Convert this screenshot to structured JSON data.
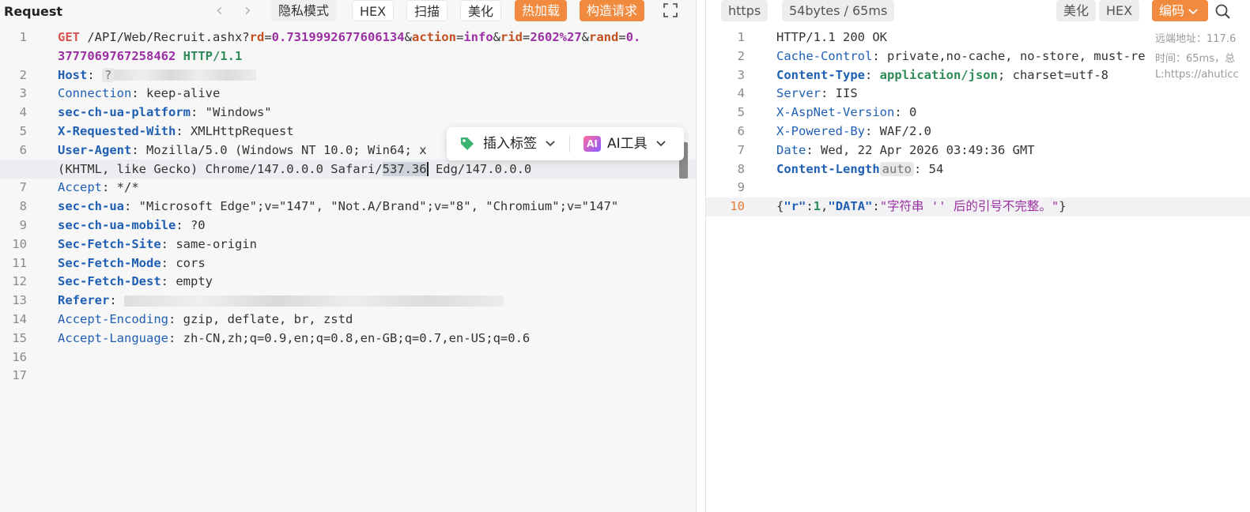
{
  "request": {
    "title": "Request",
    "nav_back": "‹",
    "nav_forward": "›",
    "buttons": {
      "private_mode": "隐私模式",
      "hex": "HEX",
      "scan": "扫描",
      "beautify": "美化",
      "hot_reload": "热加载",
      "construct": "构造请求"
    },
    "lines": [
      {
        "n": "1",
        "parts": [
          [
            "method",
            "GET"
          ],
          [
            "plain",
            " /API/Web/Recruit.ashx?"
          ],
          [
            "pname",
            "rd"
          ],
          [
            "plain",
            "="
          ],
          [
            "pval",
            "0.7319992677606134"
          ],
          [
            "plain",
            "&"
          ],
          [
            "pname",
            "action"
          ],
          [
            "plain",
            "="
          ],
          [
            "pval",
            "info"
          ],
          [
            "plain",
            "&"
          ],
          [
            "pname",
            "rid"
          ],
          [
            "plain",
            "="
          ],
          [
            "pval",
            "2602%27"
          ],
          [
            "plain",
            "&"
          ],
          [
            "pname",
            "rand"
          ],
          [
            "plain",
            "="
          ],
          [
            "pval",
            "0."
          ]
        ]
      },
      {
        "n": "",
        "parts": [
          [
            "pval",
            "3777069767258462"
          ],
          [
            "plain",
            " "
          ],
          [
            "proto",
            "HTTP/1.1"
          ]
        ]
      },
      {
        "n": "2",
        "parts": [
          [
            "keyb",
            "Host"
          ],
          [
            "plain",
            ": "
          ],
          [
            "chip",
            "?"
          ],
          [
            "blur",
            "180"
          ]
        ]
      },
      {
        "n": "3",
        "parts": [
          [
            "key",
            "Connection"
          ],
          [
            "plain",
            ": keep-alive"
          ]
        ]
      },
      {
        "n": "4",
        "parts": [
          [
            "keyb",
            "sec-ch-ua-platform"
          ],
          [
            "plain",
            ": \"Windows\""
          ]
        ]
      },
      {
        "n": "5",
        "parts": [
          [
            "keyb",
            "X-Requested-With"
          ],
          [
            "plain",
            ": XMLHttpRequest"
          ]
        ]
      },
      {
        "n": "6",
        "parts": [
          [
            "keyb",
            "User-Agent"
          ],
          [
            "plain",
            ": Mozilla/5.0 (Windows NT 10.0; Win64; x"
          ]
        ]
      },
      {
        "n": "",
        "parts": [
          [
            "plain",
            "(KHTML, like Gecko) Chrome/147.0.0.0 Safari/"
          ],
          [
            "sel",
            "537.36"
          ],
          [
            "cursor",
            ""
          ],
          [
            "plain",
            " Edg/147.0.0.0"
          ]
        ]
      },
      {
        "n": "7",
        "parts": [
          [
            "key",
            "Accept"
          ],
          [
            "plain",
            ": */*"
          ]
        ]
      },
      {
        "n": "8",
        "parts": [
          [
            "keyb",
            "sec-ch-ua"
          ],
          [
            "plain",
            ": \"Microsoft Edge\";v=\"147\", \"Not.A/Brand\";v=\"8\", \"Chromium\";v=\"147\""
          ]
        ]
      },
      {
        "n": "9",
        "parts": [
          [
            "keyb",
            "sec-ch-ua-mobile"
          ],
          [
            "plain",
            ": ?0"
          ]
        ]
      },
      {
        "n": "10",
        "parts": [
          [
            "keyb",
            "Sec-Fetch-Site"
          ],
          [
            "plain",
            ": same-origin"
          ]
        ]
      },
      {
        "n": "11",
        "parts": [
          [
            "keyb",
            "Sec-Fetch-Mode"
          ],
          [
            "plain",
            ": cors"
          ]
        ]
      },
      {
        "n": "12",
        "parts": [
          [
            "keyb",
            "Sec-Fetch-Dest"
          ],
          [
            "plain",
            ": empty"
          ]
        ]
      },
      {
        "n": "13",
        "parts": [
          [
            "keyb",
            "Referer"
          ],
          [
            "plain",
            ": "
          ],
          [
            "blur",
            "480"
          ]
        ]
      },
      {
        "n": "14",
        "parts": [
          [
            "key",
            "Accept-Encoding"
          ],
          [
            "plain",
            ": gzip, deflate, br, zstd"
          ]
        ]
      },
      {
        "n": "15",
        "parts": [
          [
            "key",
            "Accept-Language"
          ],
          [
            "plain",
            ": zh-CN,zh;q=0.9,en;q=0.8,en-GB;q=0.7,en-US;q=0.6"
          ]
        ]
      },
      {
        "n": "16",
        "parts": []
      },
      {
        "n": "17",
        "parts": []
      }
    ]
  },
  "popup": {
    "insert_tag": "插入标签",
    "ai_badge": "AI",
    "ai_tools": "AI工具"
  },
  "response": {
    "protocol_badge": "https",
    "size_time_badge": "54bytes / 65ms",
    "buttons": {
      "beautify": "美化",
      "hex": "HEX",
      "encoding": "编码"
    },
    "info": {
      "remote": "远端地址：117.6",
      "timing": "时间：65ms，总",
      "location": "L:https://ahuticc"
    },
    "lines": [
      {
        "n": "1",
        "parts": [
          [
            "plain",
            "HTTP/1.1 200 OK"
          ]
        ]
      },
      {
        "n": "2",
        "parts": [
          [
            "key",
            "Cache-Control"
          ],
          [
            "plain",
            ": private,no-cache, no-store, must-re"
          ]
        ]
      },
      {
        "n": "3",
        "parts": [
          [
            "keyb",
            "Content-Type"
          ],
          [
            "plain",
            ": "
          ],
          [
            "ctval",
            "application/json"
          ],
          [
            "plain",
            "; charset=utf-8"
          ]
        ]
      },
      {
        "n": "4",
        "parts": [
          [
            "key",
            "Server"
          ],
          [
            "plain",
            ": IIS"
          ]
        ]
      },
      {
        "n": "5",
        "parts": [
          [
            "key",
            "X-AspNet-Version"
          ],
          [
            "plain",
            ": 0"
          ]
        ]
      },
      {
        "n": "6",
        "parts": [
          [
            "key",
            "X-Powered-By"
          ],
          [
            "plain",
            ": WAF/2.0"
          ]
        ]
      },
      {
        "n": "7",
        "parts": [
          [
            "key",
            "Date"
          ],
          [
            "plain",
            ": Wed, 22 Apr 2026 03:49:36 GMT"
          ]
        ]
      },
      {
        "n": "8",
        "parts": [
          [
            "keyb",
            "Content-Length"
          ],
          [
            "chip",
            "auto"
          ],
          [
            "plain",
            ": 54"
          ]
        ]
      },
      {
        "n": "9",
        "parts": []
      },
      {
        "n": "10",
        "hl": true,
        "parts": [
          [
            "plain",
            "{"
          ],
          [
            "jkey",
            "\"r\""
          ],
          [
            "plain",
            ":"
          ],
          [
            "jnum",
            "1"
          ],
          [
            "plain",
            ","
          ],
          [
            "jkey",
            "\"DATA\""
          ],
          [
            "plain",
            ":"
          ],
          [
            "jstr",
            "\"字符串 '' 后的引号不完整。\""
          ],
          [
            "plain",
            "}"
          ]
        ]
      }
    ]
  },
  "colors": {
    "accent_orange": "#f08a3e",
    "header_key": "#1f5fb4",
    "param_value": "#9b2fa3",
    "json_value": "#2e8b57"
  }
}
